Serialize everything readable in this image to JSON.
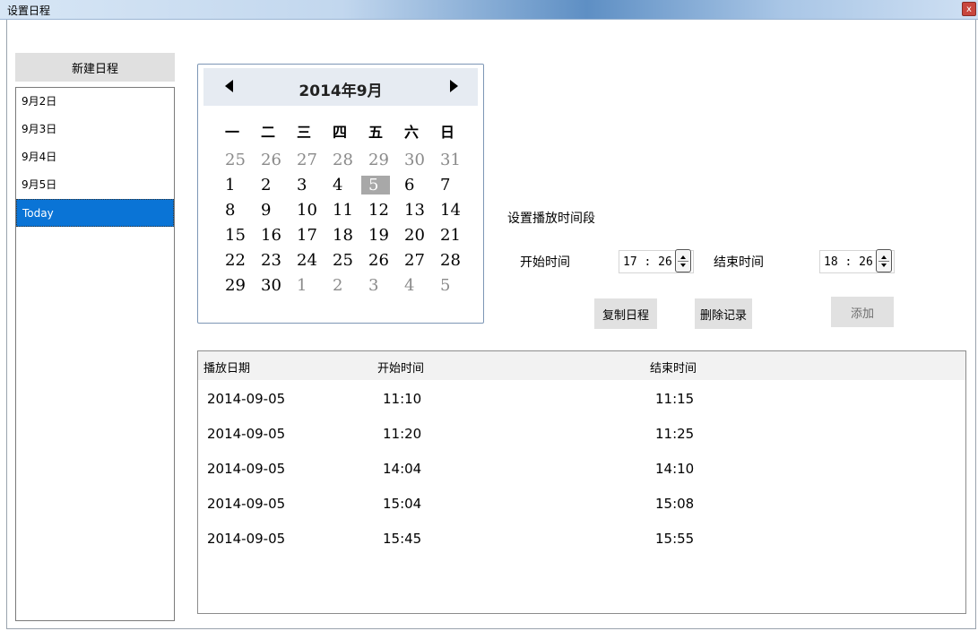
{
  "window": {
    "title": "设置日程",
    "close_glyph": "x"
  },
  "sidebar": {
    "new_button": "新建日程",
    "items": [
      {
        "label": "9月2日"
      },
      {
        "label": "9月3日"
      },
      {
        "label": "9月4日"
      },
      {
        "label": "9月5日"
      },
      {
        "label": "Today",
        "selected": true
      }
    ]
  },
  "calendar": {
    "title": "2014年9月",
    "weekdays": [
      "一",
      "二",
      "三",
      "四",
      "五",
      "六",
      "日"
    ],
    "rows": [
      [
        "25",
        "26",
        "27",
        "28",
        "29",
        "30",
        "31"
      ],
      [
        "1",
        "2",
        "3",
        "4",
        "5",
        "6",
        "7"
      ],
      [
        "8",
        "9",
        "10",
        "11",
        "12",
        "13",
        "14"
      ],
      [
        "15",
        "16",
        "17",
        "18",
        "19",
        "20",
        "21"
      ],
      [
        "22",
        "23",
        "24",
        "25",
        "26",
        "27",
        "28"
      ],
      [
        "29",
        "30",
        "1",
        "2",
        "3",
        "4",
        "5"
      ]
    ],
    "selected_day": "5"
  },
  "schedule": {
    "section_label": "设置播放时间段",
    "start_label": "开始时间",
    "start_value": "17 : 26",
    "end_label": "结束时间",
    "end_value": "18 : 26",
    "copy_button": "复制日程",
    "delete_button": "删除记录",
    "add_button": "添加"
  },
  "records": {
    "headers": [
      "播放日期",
      "开始时间",
      "结束时间"
    ],
    "rows": [
      [
        "2014-09-05",
        "11:10",
        "11:15"
      ],
      [
        "2014-09-05",
        "11:20",
        "11:25"
      ],
      [
        "2014-09-05",
        "14:04",
        "14:10"
      ],
      [
        "2014-09-05",
        "15:04",
        "15:08"
      ],
      [
        "2014-09-05",
        "15:45",
        "15:55"
      ]
    ]
  },
  "colors": {
    "selected": "#0a74d6",
    "today_highlight": "#a8a8a8"
  }
}
